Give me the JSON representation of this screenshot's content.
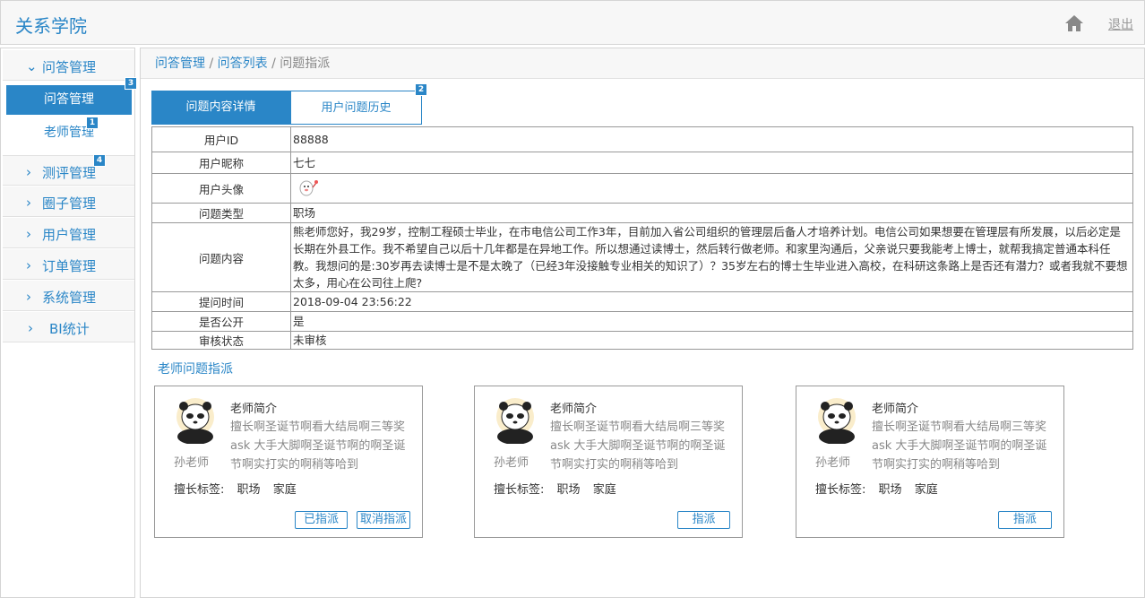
{
  "app": {
    "title": "关系学院",
    "logout": "退出"
  },
  "sidebar": {
    "groups": [
      {
        "label": "问答管理",
        "expanded": true
      },
      {
        "label": "测评管理"
      },
      {
        "label": "圈子管理"
      },
      {
        "label": "用户管理"
      },
      {
        "label": "订单管理"
      },
      {
        "label": "系统管理"
      },
      {
        "label": "BI统计"
      }
    ],
    "subitems": [
      {
        "label": "问答管理",
        "active": true
      },
      {
        "label": "老师管理"
      }
    ]
  },
  "badges": [
    "3",
    "1",
    "4",
    "2"
  ],
  "breadcrumb": {
    "item1": "问答管理",
    "sep1": " / ",
    "item2": "问答列表",
    "sep2": " / ",
    "current": "问题指派"
  },
  "tabs": [
    {
      "label": "问题内容详情",
      "active": true
    },
    {
      "label": "用户问题历史"
    }
  ],
  "detail": {
    "rows": [
      {
        "key": "用户ID",
        "value": "88888"
      },
      {
        "key": "用户昵称",
        "value": "七七"
      },
      {
        "key": "用户头像",
        "value": ""
      },
      {
        "key": "问题类型",
        "value": "职场"
      },
      {
        "key": "问题内容",
        "value": "熊老师您好，我29岁，控制工程硕士毕业，在市电信公司工作3年，目前加入省公司组织的管理层后备人才培养计划。电信公司如果想要在管理层有所发展，以后必定是长期在外县工作。我不希望自己以后十几年都是在异地工作。所以想通过读博士，然后转行做老师。和家里沟通后，父亲说只要我能考上博士，就帮我搞定普通本科任教。我想问的是:30岁再去读博士是不是太晚了（已经3年没接触专业相关的知识了）？35岁左右的博士生毕业进入高校，在科研这条路上是否还有潜力？或者我就不要想太多，用心在公司往上爬?"
      },
      {
        "key": "提问时间",
        "value": "2018-09-04 23:56:22"
      },
      {
        "key": "是否公开",
        "value": "是"
      },
      {
        "key": "审核状态",
        "value": "未审核"
      }
    ]
  },
  "assign": {
    "title": "老师问题指派",
    "cards": [
      {
        "name": "孙老师",
        "intro_title": "老师简介",
        "intro": "擅长啊圣诞节啊看大结局啊三等奖ask 大手大脚啊圣诞节啊的啊圣诞节啊实打实的啊稍等哈到",
        "tags_label": "擅长标签:",
        "tags": [
          "职场",
          "家庭"
        ],
        "buttons": [
          "已指派",
          "取消指派"
        ]
      },
      {
        "name": "孙老师",
        "intro_title": "老师简介",
        "intro": "擅长啊圣诞节啊看大结局啊三等奖ask 大手大脚啊圣诞节啊的啊圣诞节啊实打实的啊稍等哈到",
        "tags_label": "擅长标签:",
        "tags": [
          "职场",
          "家庭"
        ],
        "buttons": [
          "指派"
        ]
      },
      {
        "name": "孙老师",
        "intro_title": "老师简介",
        "intro": "擅长啊圣诞节啊看大结局啊三等奖ask 大手大脚啊圣诞节啊的啊圣诞节啊实打实的啊稍等哈到",
        "tags_label": "擅长标签:",
        "tags": [
          "职场",
          "家庭"
        ],
        "buttons": [
          "指派"
        ]
      }
    ]
  },
  "colors": {
    "accent": "#2a86c7",
    "border": "#d5d5d5",
    "panel": "#f7f7f7"
  },
  "icons": [
    "home-icon",
    "chevron-down-icon",
    "chevron-right-icon",
    "user-avatar-icon",
    "teacher-avatar-icon"
  ]
}
